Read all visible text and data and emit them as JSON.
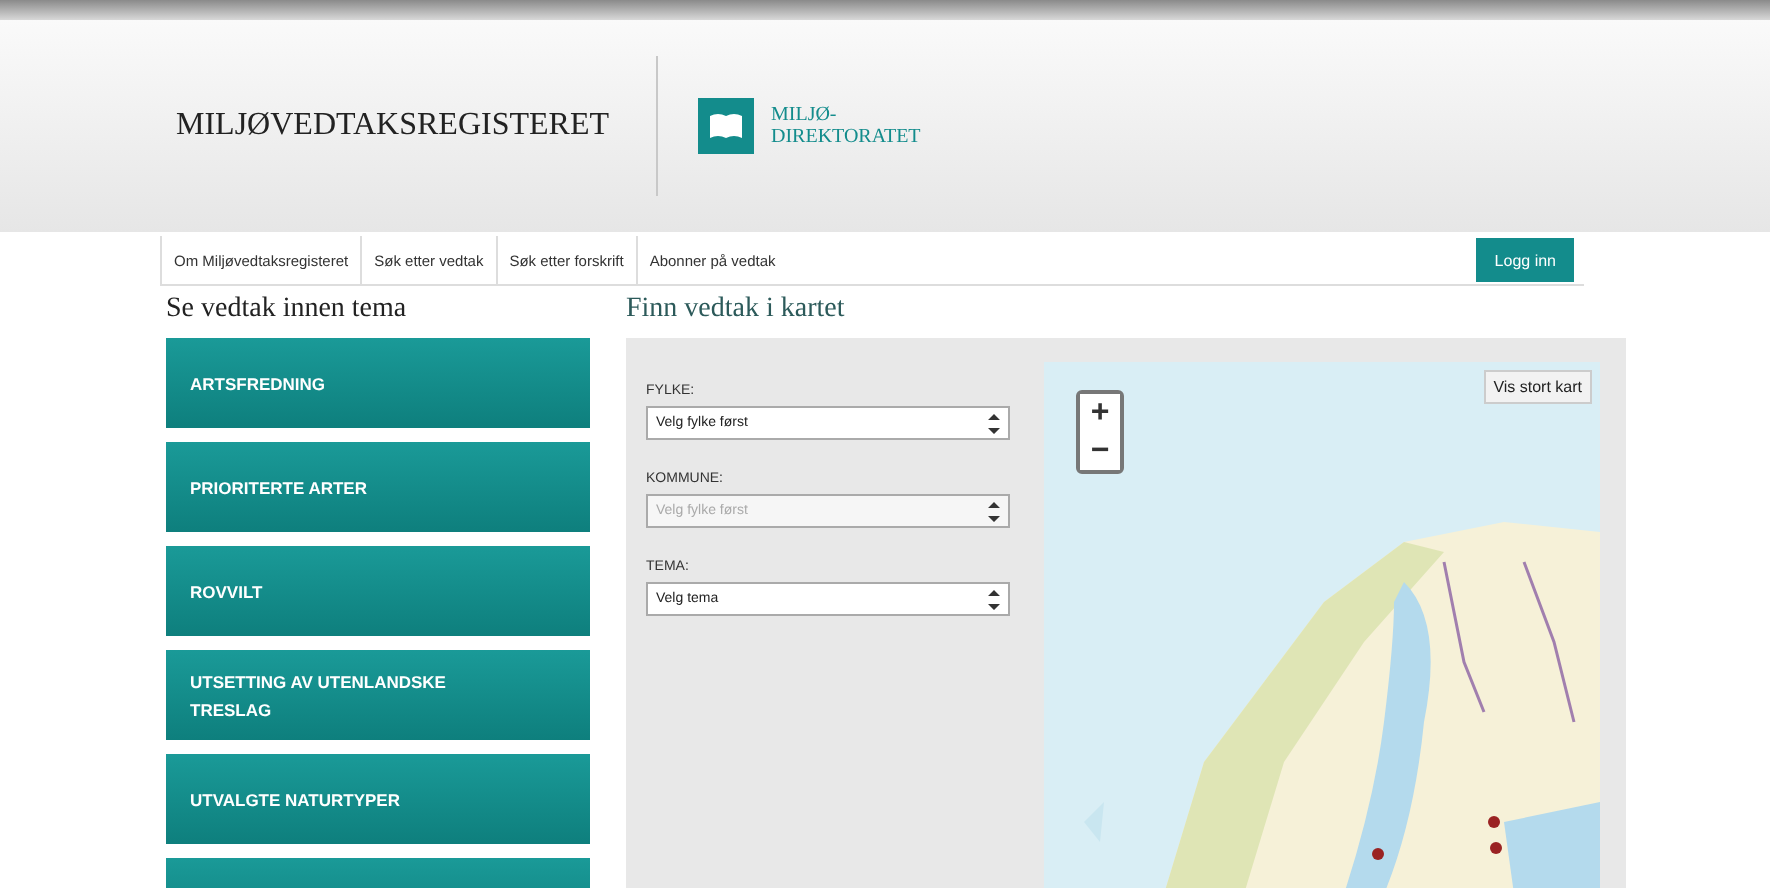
{
  "header": {
    "site_title": "MILJØVEDTAKSREGISTERET",
    "logo_lines": [
      "MILJØ-",
      "DIREKTORATET"
    ]
  },
  "nav": {
    "items": [
      {
        "label": "Om Miljøvedtaksregisteret"
      },
      {
        "label": "Søk etter vedtak"
      },
      {
        "label": "Søk etter forskrift"
      },
      {
        "label": "Abonner på vedtak"
      }
    ],
    "login": "Logg inn"
  },
  "themes": {
    "title": "Se vedtak innen tema",
    "items": [
      "ARTSFREDNING",
      "PRIORITERTE ARTER",
      "ROVVILT",
      "UTSETTING AV UTENLANDSKE TRESLAG",
      "UTVALGTE NATURTYPER"
    ],
    "more_tile_partly_visible": true
  },
  "map_section": {
    "title": "Finn vedtak i kartet",
    "fields": [
      {
        "label": "FYLKE:",
        "value": "Velg fylke først",
        "disabled": false
      },
      {
        "label": "KOMMUNE:",
        "value": "Velg fylke først",
        "disabled": true
      },
      {
        "label": "TEMA:",
        "value": "Velg tema",
        "disabled": false
      }
    ],
    "map": {
      "kind": "picture",
      "zoom_in": "+",
      "zoom_out": "−",
      "large_map_button": "Vis stort kart"
    }
  }
}
